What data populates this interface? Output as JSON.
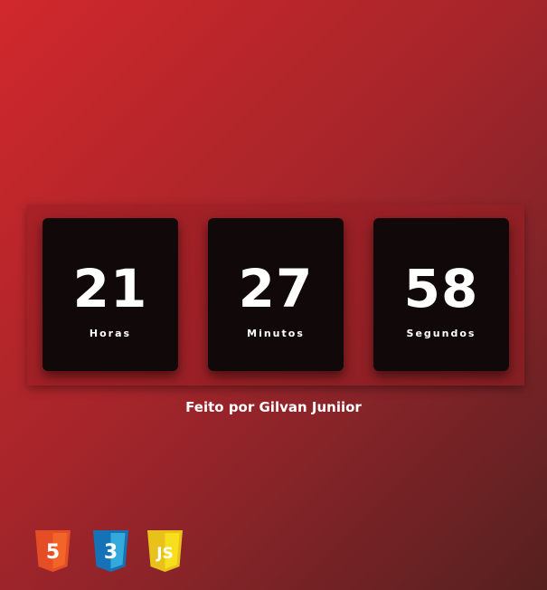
{
  "timer": {
    "hours": {
      "value": "21",
      "label": "Horas"
    },
    "minutes": {
      "value": "27",
      "label": "Minutos"
    },
    "seconds": {
      "value": "58",
      "label": "Segundos"
    }
  },
  "footer": {
    "credit": "Feito por Gilvan Juniior"
  },
  "tech_badges": [
    {
      "icon": "html5-icon",
      "glyph": "5",
      "color": "#e44d26"
    },
    {
      "icon": "css3-icon",
      "glyph": "3",
      "color": "#1572b6"
    },
    {
      "icon": "javascript-icon",
      "glyph": "JS",
      "color": "#f0db4f"
    }
  ]
}
